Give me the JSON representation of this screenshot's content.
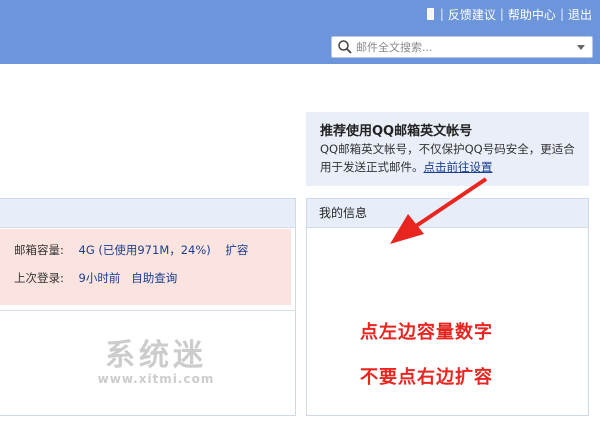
{
  "toplinks": {
    "feedback": "反馈建议",
    "help": "帮助中心",
    "logout": "退出",
    "separator": "|"
  },
  "search": {
    "placeholder": "邮件全文搜索..."
  },
  "promo": {
    "title": "推荐使用QQ邮箱英文帐号",
    "text": "QQ邮箱英文帐号，不仅保护QQ号码安全，更适合用于发送正式邮件。",
    "link": "点击前往设置"
  },
  "info": {
    "title": "我的信息",
    "capacity_label": "邮箱容量:",
    "capacity_value": "4G (已使用971M，24%)",
    "expand_link": "扩容",
    "lastlogin_label": "上次登录:",
    "lastlogin_value": "9小时前",
    "selfquery_link": "自助查询"
  },
  "annotation": {
    "line1": "点左边容量数字",
    "line2": "不要点右边扩容"
  },
  "watermark": {
    "main": "系统迷",
    "url": "www.xitmi.com"
  },
  "colors": {
    "topbar": "#6c95dc",
    "annotation": "#e8251f",
    "link": "#1a3e8e",
    "pink": "#fbe4e0"
  }
}
